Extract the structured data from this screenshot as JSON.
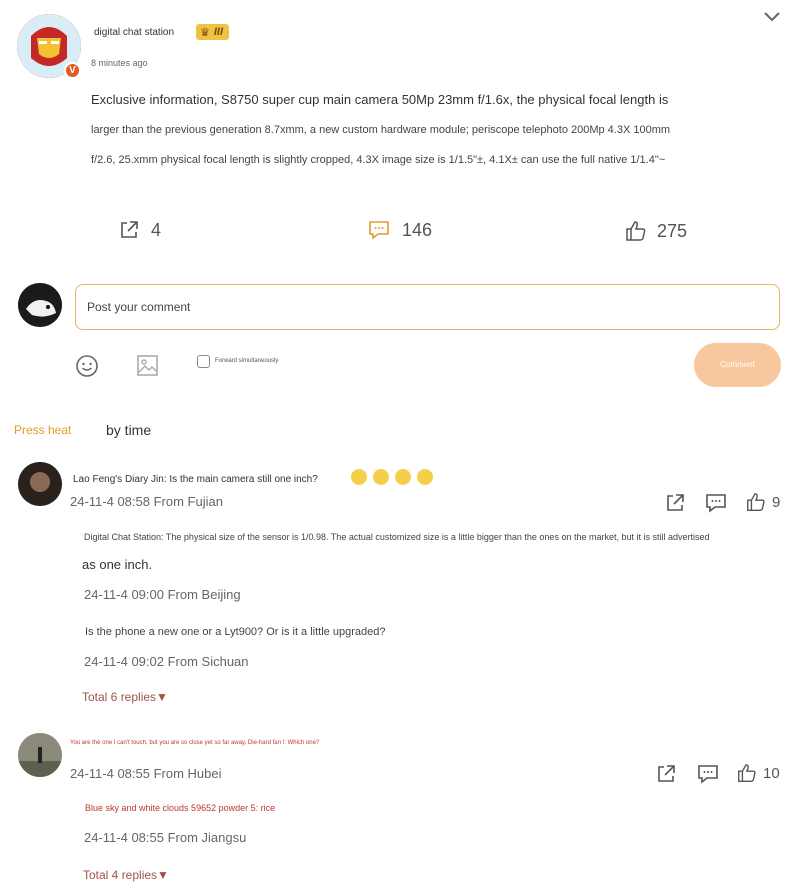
{
  "post": {
    "username": "digital chat station",
    "rank_badge": "III",
    "time": "8 minutes ago",
    "text_line1": "Exclusive information, S8750 super cup main camera 50Mp 23mm f/1.6x, the physical focal length is",
    "text_line2": "larger than the previous generation 8.7xmm, a new custom hardware module; periscope telephoto 200Mp 4.3X 100mm",
    "text_line3": "f/2.6, 25.xmm physical focal length is slightly cropped, 4.3X image size is 1/1.5\"±, 4.1X± can use the full native 1/1.4\"~",
    "verified_badge": "V",
    "forward_count": "4",
    "comment_count": "146",
    "like_count": "275"
  },
  "composer": {
    "placeholder": "Post your comment",
    "forward_label": "Forward simultaneously",
    "submit_label": "Comment"
  },
  "sort": {
    "tab_heat": "Press heat",
    "tab_time": "by time"
  },
  "comments": [
    {
      "author": "Lao Feng's Diary Jin:",
      "text": "Is the main camera still one inch?",
      "meta": "24-11-4 08:58 From Fujian",
      "likes": "9",
      "replies": [
        {
          "author": "Digital Chat Station:",
          "text1": "The physical size of the sensor is 1/0.98. The actual customized size is a little bigger than the ones on the market, but it is still advertised",
          "text2": "as one inch.",
          "meta": "24-11-4 09:00 From Beijing"
        },
        {
          "text": "Is the phone a new one or a Lyt900? Or is it a little upgraded?",
          "meta": "24-11-4 09:02 From Sichuan"
        }
      ],
      "total_replies": "Total 6 replies▼"
    },
    {
      "author": "You are the one I can't touch, but you are so close yet so far away, Die-hard fan !: Which one?",
      "meta": "24-11-4 08:55 From Hubei",
      "likes": "10",
      "replies": [
        {
          "text": "Blue sky and white clouds 59652 powder 5: rice",
          "meta": "24-11-4 08:55 From Jiangsu"
        }
      ],
      "total_replies": "Total 4 replies▼"
    }
  ],
  "colors": {
    "accent": "#e39b2c",
    "link": "#a0524a",
    "button_bg": "#f7c79d"
  }
}
